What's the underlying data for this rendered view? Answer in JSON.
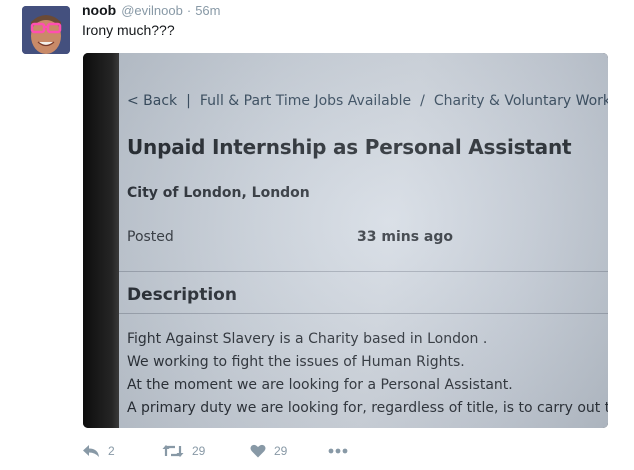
{
  "tweet": {
    "author_name": "noob",
    "author_handle": "@evilnoob",
    "separator": "·",
    "time": "56m",
    "text": "Irony much???",
    "avatar": "avatar-photo"
  },
  "photo": {
    "breadcrumb": {
      "back_label": "< Back",
      "bar": "|",
      "item1": "Full & Part Time Jobs Available",
      "slash": "/",
      "item2": "Charity & Voluntary Work"
    },
    "job_title": "Unpaid Internship as Personal Assistant",
    "location": "City of London, London",
    "posted_label": "Posted",
    "posted_value": "33 mins ago",
    "description_heading": "Description",
    "description_lines": [
      "Fight Against Slavery is a Charity based in London .",
      "We working to fight the issues of Human Rights.",
      "At the moment we are looking for a Personal Assistant.",
      "A primary duty we are looking for, regardless of title, is to carry out th"
    ]
  },
  "actions": {
    "reply_count": "2",
    "retweet_count": "29",
    "like_count": "29",
    "icons": [
      "reply-icon",
      "retweet-icon",
      "like-icon",
      "more-icon"
    ],
    "icon_color": "#8899a6"
  }
}
